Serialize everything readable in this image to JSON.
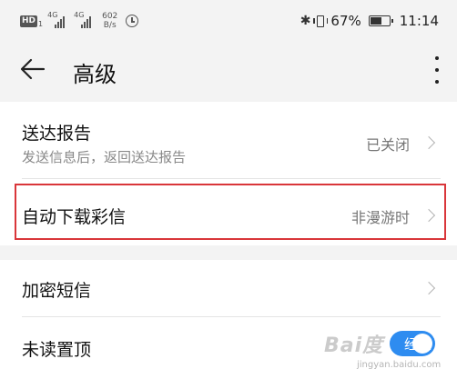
{
  "status_bar": {
    "hd_badge": "HD",
    "hd_num": "1",
    "network_1": "4G",
    "network_2": "4G",
    "speed_value": "602",
    "speed_unit": "B/s",
    "battery_percent": "67%",
    "battery_level": 0.67,
    "time": "11:14"
  },
  "toolbar": {
    "title": "高级"
  },
  "settings": {
    "delivery_report": {
      "title": "送达报告",
      "subtitle": "发送信息后，返回送达报告",
      "value": "已关闭"
    },
    "auto_download_mms": {
      "title": "自动下载彩信",
      "value": "非漫游时"
    },
    "encrypted_sms": {
      "title": "加密短信"
    },
    "pin_unread": {
      "title": "未读置顶",
      "toggle_label": "经验",
      "toggle_on": true
    }
  },
  "watermark": {
    "text": "Bai度",
    "url": "jingyan.baidu.com"
  },
  "colors": {
    "highlight_border": "#d9363a",
    "toggle_on": "#2e8cf0"
  }
}
